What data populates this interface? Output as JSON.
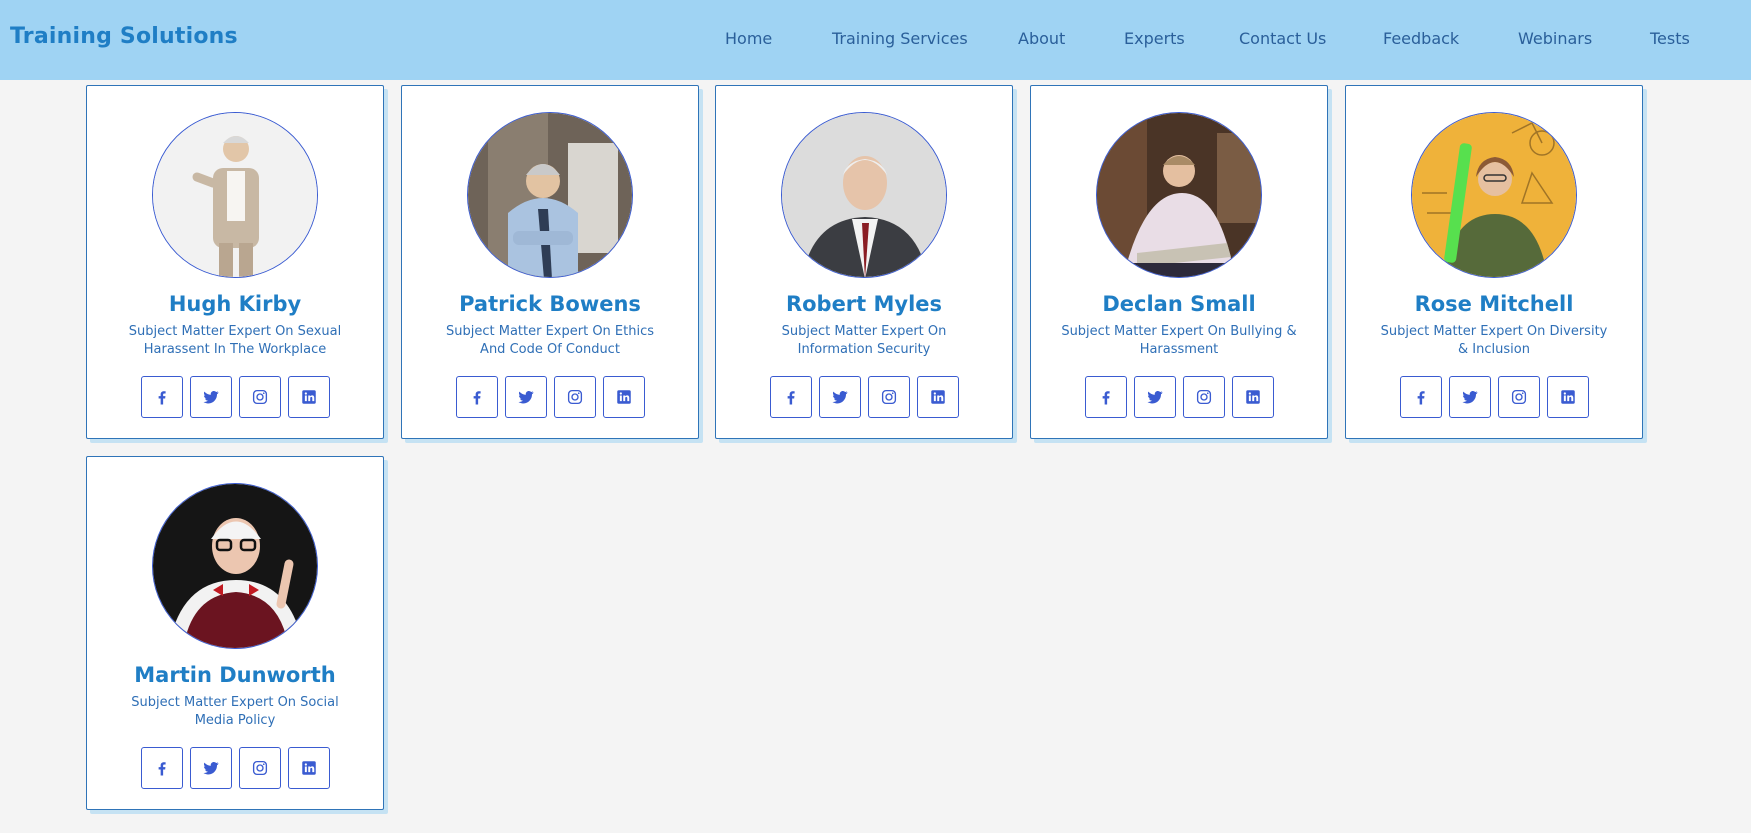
{
  "header": {
    "brand": "Training Solutions",
    "nav": [
      {
        "label": "Home"
      },
      {
        "label": "Training Services"
      },
      {
        "label": "About"
      },
      {
        "label": "Experts"
      },
      {
        "label": "Contact Us"
      },
      {
        "label": "Feedback"
      },
      {
        "label": "Webinars"
      },
      {
        "label": "Tests"
      }
    ]
  },
  "experts": [
    {
      "name": "Hugh Kirby",
      "role": "Subject Matter Expert On Sexual Harassent In The Workplace"
    },
    {
      "name": "Patrick Bowens",
      "role": "Subject Matter Expert On Ethics And Code Of Conduct"
    },
    {
      "name": "Robert Myles",
      "role": "Subject Matter Expert On Information Security"
    },
    {
      "name": "Declan Small",
      "role": "Subject Matter Expert On Bullying & Harassment"
    },
    {
      "name": "Rose Mitchell",
      "role": "Subject Matter Expert On Diversity & Inclusion"
    },
    {
      "name": "Martin Dunworth",
      "role": "Subject Matter Expert On Social Media Policy"
    }
  ],
  "social_icons": [
    "facebook-icon",
    "twitter-icon",
    "instagram-icon",
    "linkedin-icon"
  ],
  "colors": {
    "header_bg": "#9fd3f3",
    "brand": "#1f7ec5",
    "accent": "#3a5bd1",
    "page_bg": "#f4f4f4"
  }
}
